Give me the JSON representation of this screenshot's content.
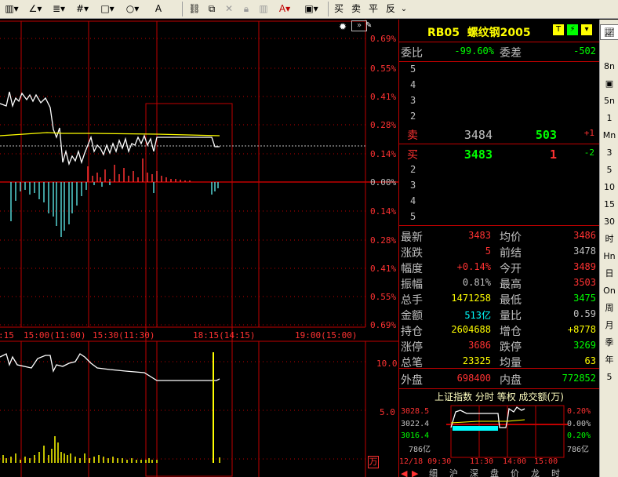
{
  "toolbar": {
    "draw_buttons": [
      "▥▾",
      "∠▾",
      "≣▾",
      "#▾",
      "□▾",
      "○▾",
      "A"
    ],
    "edit_icons": [
      "link-icon",
      "copy-icon",
      "delete-icon",
      "lock-icon",
      "color-icon",
      "save-icon"
    ],
    "trade_buttons": [
      "买",
      "卖",
      "平",
      "反"
    ]
  },
  "chart": {
    "y_labels_pct": [
      "0.69%",
      "0.55%",
      "0.41%",
      "0.28%",
      "0.14%",
      "0.00%",
      "0.14%",
      "0.28%",
      "0.41%",
      "0.55%",
      "0.69%"
    ],
    "x_labels": [
      "15:00(11:00)",
      "15:30(11:30)",
      "18:15(14:15)",
      "19:00(15:00)"
    ],
    "x_label_first": ":15",
    "volume_labels": [
      "10.0",
      "5.0"
    ],
    "volume_unit": "万"
  },
  "quote": {
    "code": "RB05",
    "name": "螺纹钢2005",
    "weibi_label": "委比",
    "weibi_value": "-99.60%",
    "weicha_label": "委差",
    "weicha_value": "-502",
    "sell_levels": [
      "5",
      "4",
      "3",
      "2"
    ],
    "sell1": {
      "label": "卖",
      "price": "3484",
      "volume": "503",
      "change": "+1"
    },
    "buy1": {
      "label": "买",
      "price": "3483",
      "volume": "1",
      "change": "-2"
    },
    "buy_levels": [
      "2",
      "3",
      "4",
      "5"
    ],
    "stats": [
      {
        "l1": "最新",
        "v1": "3483",
        "c1": "#ff3232",
        "l2": "均价",
        "v2": "3486",
        "c2": "#ff3232"
      },
      {
        "l1": "涨跌",
        "v1": "5",
        "c1": "#ff3232",
        "l2": "前结",
        "v2": "3478",
        "c2": "#c0c0c0"
      },
      {
        "l1": "幅度",
        "v1": "+0.14%",
        "c1": "#ff3232",
        "l2": "今开",
        "v2": "3489",
        "c2": "#ff3232"
      },
      {
        "l1": "振幅",
        "v1": "0.81%",
        "c1": "#c0c0c0",
        "l2": "最高",
        "v2": "3503",
        "c2": "#ff3232"
      },
      {
        "l1": "总手",
        "v1": "1471258",
        "c1": "#ffff00",
        "l2": "最低",
        "v2": "3475",
        "c2": "#00ff00"
      },
      {
        "l1": "金额",
        "v1": "513亿",
        "c1": "#00ffff",
        "l2": "量比",
        "v2": "0.59",
        "c2": "#c0c0c0"
      },
      {
        "l1": "持仓",
        "v1": "2604688",
        "c1": "#ffff00",
        "l2": "增仓",
        "v2": "+8778",
        "c2": "#ffff00"
      },
      {
        "l1": "涨停",
        "v1": "3686",
        "c1": "#ff3232",
        "l2": "跌停",
        "v2": "3269",
        "c2": "#00ff00"
      },
      {
        "l1": "总笔",
        "v1": "23325",
        "c1": "#ffff00",
        "l2": "均量",
        "v2": "63",
        "c2": "#ffff00"
      }
    ],
    "outer_label": "外盘",
    "outer_value": "698400",
    "inner_label": "内盘",
    "inner_value": "772852"
  },
  "mini": {
    "title": "上证指数 分时 等权 成交额(万)",
    "left_labels": [
      "3028.5",
      "3022.4",
      "3016.4",
      "786亿"
    ],
    "right_labels": [
      "0.20%",
      "0.00%",
      "0.20%",
      "786亿"
    ],
    "x_labels": [
      "12/18 09:30",
      "11:30",
      "14:00",
      "15:00"
    ]
  },
  "bottom_tabs": [
    "细",
    "沪",
    "深",
    "盘",
    "价",
    "龙",
    "时"
  ],
  "sidebar": [
    "",
    "",
    "8n",
    "",
    "5n",
    "1",
    "Mn",
    "3",
    "5",
    "10",
    "15",
    "30",
    "时",
    "Hn",
    "日",
    "On",
    "周",
    "月",
    "季",
    "年",
    "5"
  ],
  "colors": {
    "up": "#ff3232",
    "down": "#00ff00",
    "price_line": "#ffffff",
    "avg_line": "#ffff00",
    "grid": "#c00000",
    "volume_down": "#54d2d2"
  }
}
